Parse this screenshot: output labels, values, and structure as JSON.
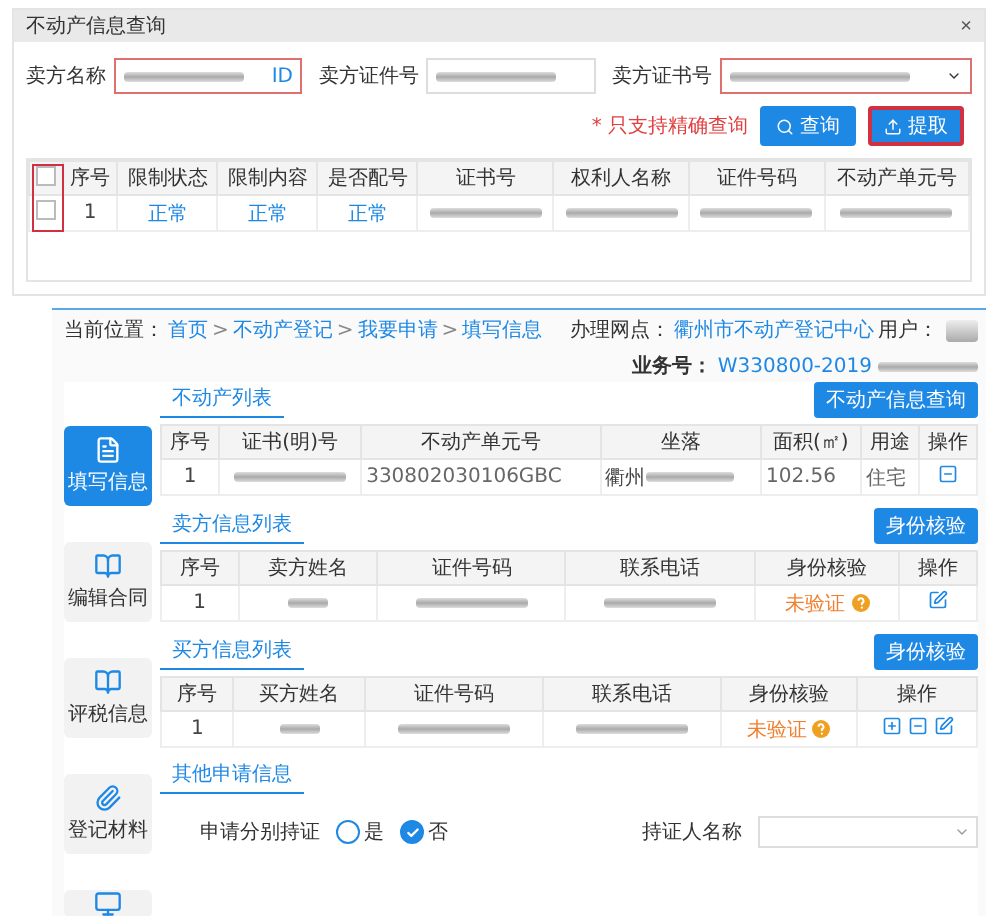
{
  "dialog": {
    "title": "不动产信息查询",
    "close": "×",
    "fields": [
      {
        "label": "卖方名称",
        "kind": "input",
        "suffix": "ID",
        "invalid": true
      },
      {
        "label": "卖方证件号",
        "kind": "input",
        "invalid": false
      },
      {
        "label": "卖方证书号",
        "kind": "select",
        "invalid": true
      }
    ],
    "note": "* 只支持精确查询",
    "buttons": [
      {
        "label": "查询",
        "kind": "search",
        "highlighted": false
      },
      {
        "label": "提取",
        "kind": "extract",
        "highlighted": true
      }
    ],
    "table": {
      "checkbox_column_highlighted": true,
      "all_checked": false,
      "columns": [
        "序号",
        "限制状态",
        "限制内容",
        "是否配号",
        "证书号",
        "权利人名称",
        "证件号码",
        "不动产单元号"
      ],
      "rows": [
        {
          "checked": false,
          "cells": [
            "1",
            {
              "kind": "link",
              "text": "正常"
            },
            {
              "kind": "link",
              "text": "正常"
            },
            {
              "kind": "link",
              "text": "正常"
            },
            {
              "kind": "redacted"
            },
            {
              "kind": "redacted"
            },
            {
              "kind": "redacted"
            },
            {
              "kind": "redacted"
            }
          ]
        }
      ]
    }
  },
  "form": {
    "breadcrumb_label": "当前位置：",
    "breadcrumb": [
      {
        "label": "首页"
      },
      {
        "label": "不动产登记"
      },
      {
        "label": "我要申请"
      },
      {
        "label": "填写信息"
      }
    ],
    "breadcrumb_separator": ">",
    "office_label": "办理网点：",
    "office": "衢州市不动产登记中心",
    "user_label": "用户：",
    "business_no_label": "业务号：",
    "business_no": "W330800-2019",
    "steps": [
      {
        "label": "填写信息",
        "kind": "form",
        "selected": true
      },
      {
        "label": "编辑合同",
        "kind": "book",
        "selected": false
      },
      {
        "label": "评税信息",
        "kind": "book",
        "selected": false
      },
      {
        "label": "登记材料",
        "kind": "clip",
        "selected": false
      },
      {
        "kind": "screen",
        "selected": false
      }
    ],
    "sections": [
      {
        "title": "不动产列表",
        "button": "不动产信息查询",
        "columns": [
          "序号",
          "证书(明)号",
          "不动产单元号",
          "坐落",
          "面积(㎡)",
          "用途",
          "操作"
        ],
        "rows": [
          [
            "1",
            {
              "kind": "redacted"
            },
            {
              "kind": "muted",
              "text": "330802030106GBC"
            },
            {
              "kind": "partial",
              "text": "衢州"
            },
            {
              "kind": "muted",
              "text": "102.56"
            },
            {
              "kind": "muted",
              "text": "住宅"
            },
            {
              "kind": "actions",
              "actions": [
                {
                  "kind": "remove"
                }
              ]
            }
          ]
        ]
      },
      {
        "title": "卖方信息列表",
        "button": "身份核验",
        "columns": [
          "序号",
          "卖方姓名",
          "证件号码",
          "联系电话",
          "身份核验",
          "操作"
        ],
        "rows": [
          [
            "1",
            {
              "kind": "redacted_short"
            },
            {
              "kind": "redacted"
            },
            {
              "kind": "redacted"
            },
            {
              "kind": "status",
              "text": "未验证"
            },
            {
              "kind": "actions",
              "actions": [
                {
                  "kind": "edit"
                }
              ]
            }
          ]
        ]
      },
      {
        "title": "买方信息列表",
        "button": "身份核验",
        "columns": [
          "序号",
          "买方姓名",
          "证件号码",
          "联系电话",
          "身份核验",
          "操作"
        ],
        "rows": [
          [
            "1",
            {
              "kind": "redacted_short"
            },
            {
              "kind": "redacted"
            },
            {
              "kind": "redacted"
            },
            {
              "kind": "status",
              "text": "未验证"
            },
            {
              "kind": "actions",
              "actions": [
                {
                  "kind": "add"
                },
                {
                  "kind": "remove"
                },
                {
                  "kind": "edit"
                }
              ]
            }
          ]
        ]
      }
    ],
    "other": {
      "title": "其他申请信息",
      "separate_label": "申请分别持证",
      "options": [
        {
          "label": "是",
          "selected": false
        },
        {
          "label": "否",
          "selected": true
        }
      ],
      "holder_label": "持证人名称"
    }
  }
}
